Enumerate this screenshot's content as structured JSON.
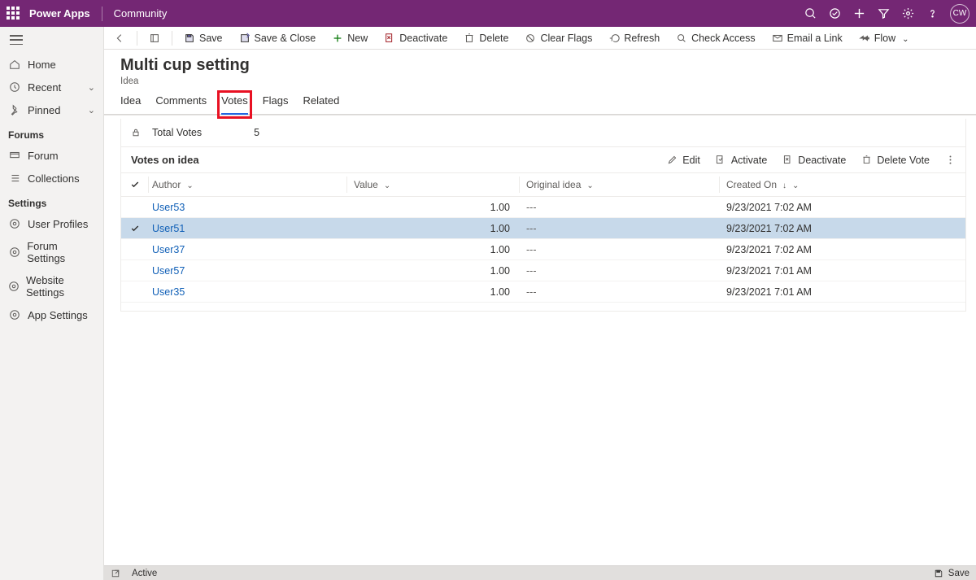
{
  "topbar": {
    "app_name": "Power Apps",
    "context": "Community",
    "avatar_initials": "CW"
  },
  "sidebar": {
    "nav_home": "Home",
    "nav_recent": "Recent",
    "nav_pinned": "Pinned",
    "section_forums": "Forums",
    "nav_forum": "Forum",
    "nav_collections": "Collections",
    "section_settings": "Settings",
    "nav_user_profiles": "User Profiles",
    "nav_forum_settings": "Forum Settings",
    "nav_website_settings": "Website Settings",
    "nav_app_settings": "App Settings"
  },
  "commands": {
    "save": "Save",
    "save_close": "Save & Close",
    "new": "New",
    "deactivate": "Deactivate",
    "delete": "Delete",
    "clear_flags": "Clear Flags",
    "refresh": "Refresh",
    "check_access": "Check Access",
    "email_link": "Email a Link",
    "flow": "Flow"
  },
  "record": {
    "title": "Multi cup setting",
    "entity": "Idea"
  },
  "tabs": {
    "idea": "Idea",
    "comments": "Comments",
    "votes": "Votes",
    "flags": "Flags",
    "related": "Related"
  },
  "panel": {
    "total_votes_label": "Total Votes",
    "total_votes_value": "5",
    "subgrid_title": "Votes on idea",
    "actions": {
      "edit": "Edit",
      "activate": "Activate",
      "deactivate": "Deactivate",
      "delete_vote": "Delete Vote"
    },
    "columns": {
      "author": "Author",
      "value": "Value",
      "original_idea": "Original idea",
      "created_on": "Created On"
    },
    "rows": [
      {
        "author": "User53",
        "value": "1.00",
        "original": "---",
        "created": "9/23/2021 7:02 AM",
        "selected": false
      },
      {
        "author": "User51",
        "value": "1.00",
        "original": "---",
        "created": "9/23/2021 7:02 AM",
        "selected": true
      },
      {
        "author": "User37",
        "value": "1.00",
        "original": "---",
        "created": "9/23/2021 7:02 AM",
        "selected": false
      },
      {
        "author": "User57",
        "value": "1.00",
        "original": "---",
        "created": "9/23/2021 7:01 AM",
        "selected": false
      },
      {
        "author": "User35",
        "value": "1.00",
        "original": "---",
        "created": "9/23/2021 7:01 AM",
        "selected": false
      }
    ]
  },
  "statusbar": {
    "status": "Active",
    "save": "Save"
  }
}
